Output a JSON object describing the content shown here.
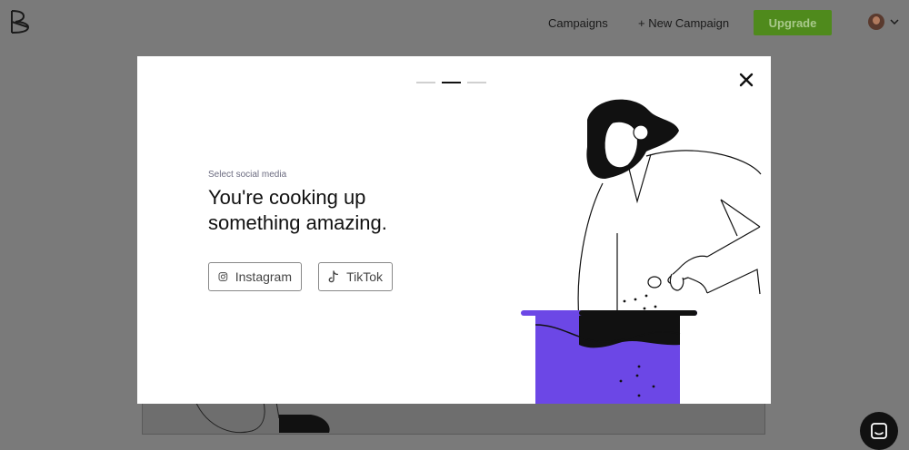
{
  "nav": {
    "campaigns": "Campaigns",
    "new_campaign": "+ New Campaign",
    "upgrade": "Upgrade"
  },
  "modal": {
    "step_count": 3,
    "active_step": 2,
    "eyebrow": "Select social media",
    "headline": "You're cooking up something amazing.",
    "instagram_label": "Instagram",
    "tiktok_label": "TikTok"
  },
  "icons": {
    "logo": "brand-logo-icon",
    "close": "close-icon",
    "instagram": "instagram-icon",
    "tiktok": "tiktok-icon",
    "chevron": "chevron-down-icon",
    "chat": "chat-icon"
  },
  "colors": {
    "accent": "#6c47e6",
    "upgrade_bg": "#4f8a1c",
    "overlay": "#7a7a7a"
  }
}
